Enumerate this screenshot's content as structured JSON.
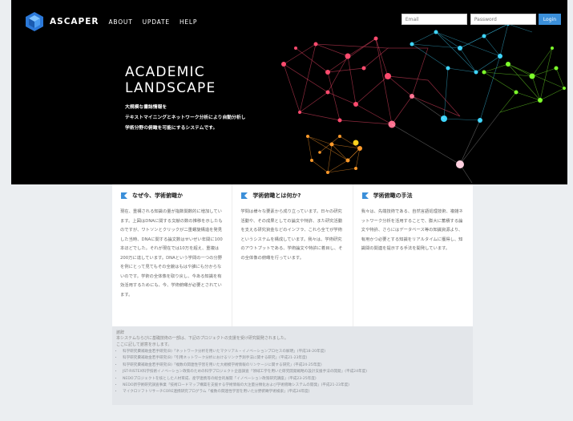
{
  "header": {
    "brand": "ASCAPER",
    "nav": [
      "ABOUT",
      "UPDATE",
      "HELP"
    ],
    "email_placeholder": "Email",
    "password_placeholder": "Password",
    "login_label": "Login"
  },
  "hero": {
    "title_line1": "ACADEMIC",
    "title_line2": "LANDSCAPE",
    "lines": [
      "大規模な書誌情報を",
      "テキストマイニングとネットワーク分析により自動分析し",
      "学術分野の俯瞰を可能にするシステムです。"
    ]
  },
  "columns": [
    {
      "title": "なぜ今、学術俯瞰か",
      "body": "現在、重構される知識の量が指数関数的に増加しています。上図はDNAに関する文献の数の推移を示したものですが、ワトソンとクリックが二重螺旋構造を発見した当時、DNAに関する論文数はせいぜい年間に100本ほどでした。それが現在では10万を超え、重複は200万に達しています。DNAという学問の一つの分野を例にとって見てもその全貌はもはや誰にも分からないのです。学術の全体像を取り戻し、今ある知識を有効活用するためにも、今、学術俯瞰が必要とされています。"
    },
    {
      "title": "学術俯瞰とは何か?",
      "body": "学問は様々な要素から成り立っています。日々の研究活動や、その成果としての論文や特許、また研究活動を支える研究資金などのインフラ、これら全てが学術というシステムを構成しています。我々は、学術研究のアウトプットである、学術論文や特許に着目し、その全体像の俯瞰を行っています。"
    },
    {
      "title": "学術俯瞰の手法",
      "body": "我々は、先端技術である、自然言語処理技術、複雑ネットワーク分析を活用することで、膨大に蓄積する論文や特許、さらにはデータベース等の知識資源より、有用かつ必要とする知識をリアルタイムに獲得し、知識間の関連を提示する手法を開発しています。"
    }
  ],
  "notes": {
    "title": "謝辞",
    "intro": [
      "本システムならびに基礎技術の一部は、下記のプロジェクトの支援を受け研究開発されました。",
      "ここに記して謝意を示します。"
    ],
    "items": [
      "科学研究費補助金若手研究(B)「ネットワーク分析を用いたマクリアル・イノベーションプロセスの解明」(平成18-20年度)",
      "科学研究費補助金若手研究(B)「引用ネットワーク分析におけるリンク予測手法に関する研究」(平成21-23年度)",
      "科学研究費補助金若手研究(B)「複数の関連性学習を用いた大規模学術情報のリンケージに関する研究」(平成24-25年度)",
      "JST-RISTEX科学技術イノベーション政策のための科学プロジェクト企画調査「領域工学を用いた研究開発戦略の設計支援手法の開発」(平成24年度)",
      "NEDOプロジェクトを核とした人材育成、産学連携等の総合的展開「イノベーション政策研究講座」(平成23-25年度)",
      "NEDO新学術研究調査事業「技術ロードマップ構築を支援する学術情報の大注量分類化および学術俯瞰システムの開発」(平成21-23年度)",
      "マイクロソフトリサーチCORE連携研究プログラム「複数の関連性学習を用いた分野俯瞰学術検索」(平成24年度)"
    ]
  },
  "colors": {
    "hero_bg": "#000000",
    "accent": "#3b8fd9",
    "page_bg": "#ebeef1"
  }
}
